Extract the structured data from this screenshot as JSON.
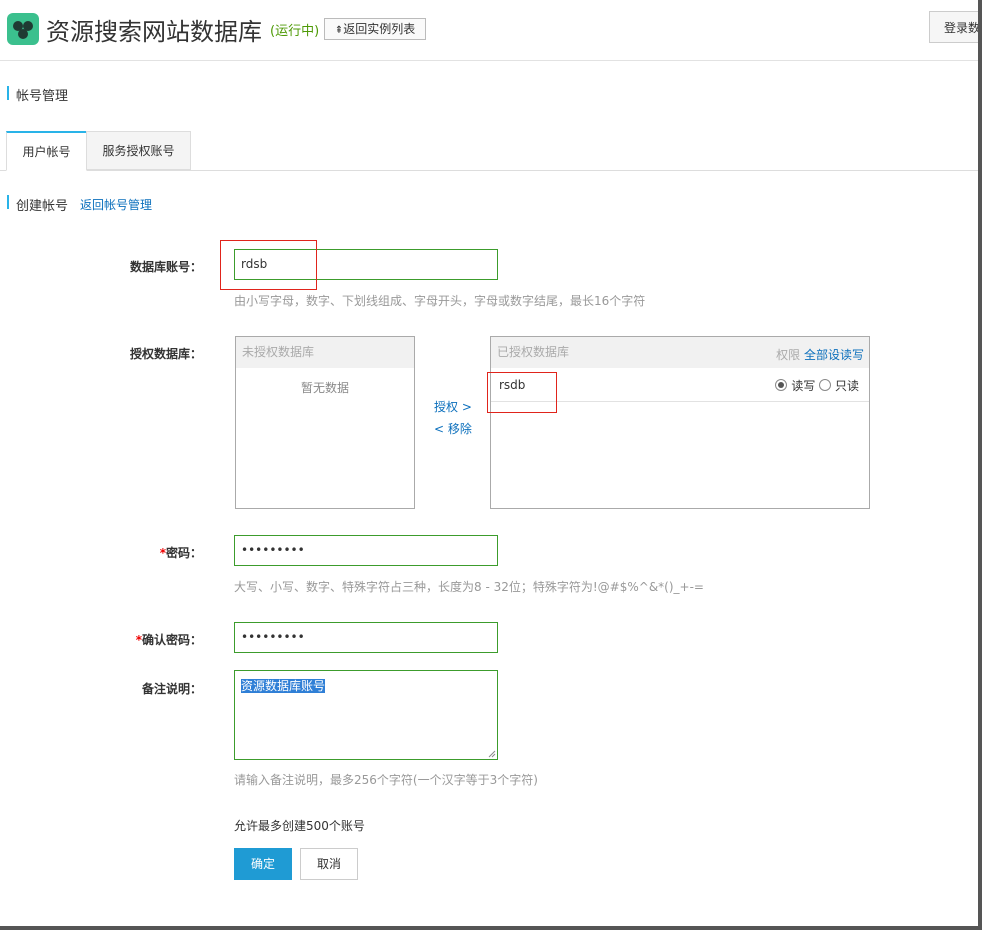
{
  "header": {
    "title": "资源搜索网站数据库",
    "status": "(运行中)",
    "back_button": "返回实例列表",
    "login_button": "登录数"
  },
  "section": {
    "title": "帐号管理"
  },
  "tabs": [
    {
      "label": "用户帐号",
      "active": true
    },
    {
      "label": "服务授权账号",
      "active": false
    }
  ],
  "subsection": {
    "title": "创建帐号",
    "back_link": "返回帐号管理"
  },
  "form": {
    "account": {
      "label": "数据库账号：",
      "value": "rdsb",
      "hint": "由小写字母，数字、下划线组成、字母开头，字母或数字结尾，最长16个字符"
    },
    "authdb": {
      "label": "授权数据库：",
      "unauthorized_header": "未授权数据库",
      "unauthorized_empty": "暂无数据",
      "grant": "授权 >",
      "remove": "< 移除",
      "authorized_header": "已授权数据库",
      "permission_label": "权限",
      "set_all": "全部设读写",
      "rows": [
        {
          "db": "rsdb",
          "read_write": "读写",
          "read_only": "只读",
          "selected": "读写"
        }
      ]
    },
    "password": {
      "required_mark": "*",
      "label": "密码：",
      "value": "•••••••••",
      "hint": "大写、小写、数字、特殊字符占三种，长度为8 - 32位；特殊字符为!@#$%^&*()_+-="
    },
    "confirm_password": {
      "required_mark": "*",
      "label": "确认密码：",
      "value": "•••••••••"
    },
    "remark": {
      "label": "备注说明：",
      "value": "资源数据库账号",
      "hint": "请输入备注说明，最多256个字符(一个汉字等于3个字符)"
    },
    "limit_note": "允许最多创建500个账号",
    "confirm_button": "确定",
    "cancel_button": "取消"
  }
}
